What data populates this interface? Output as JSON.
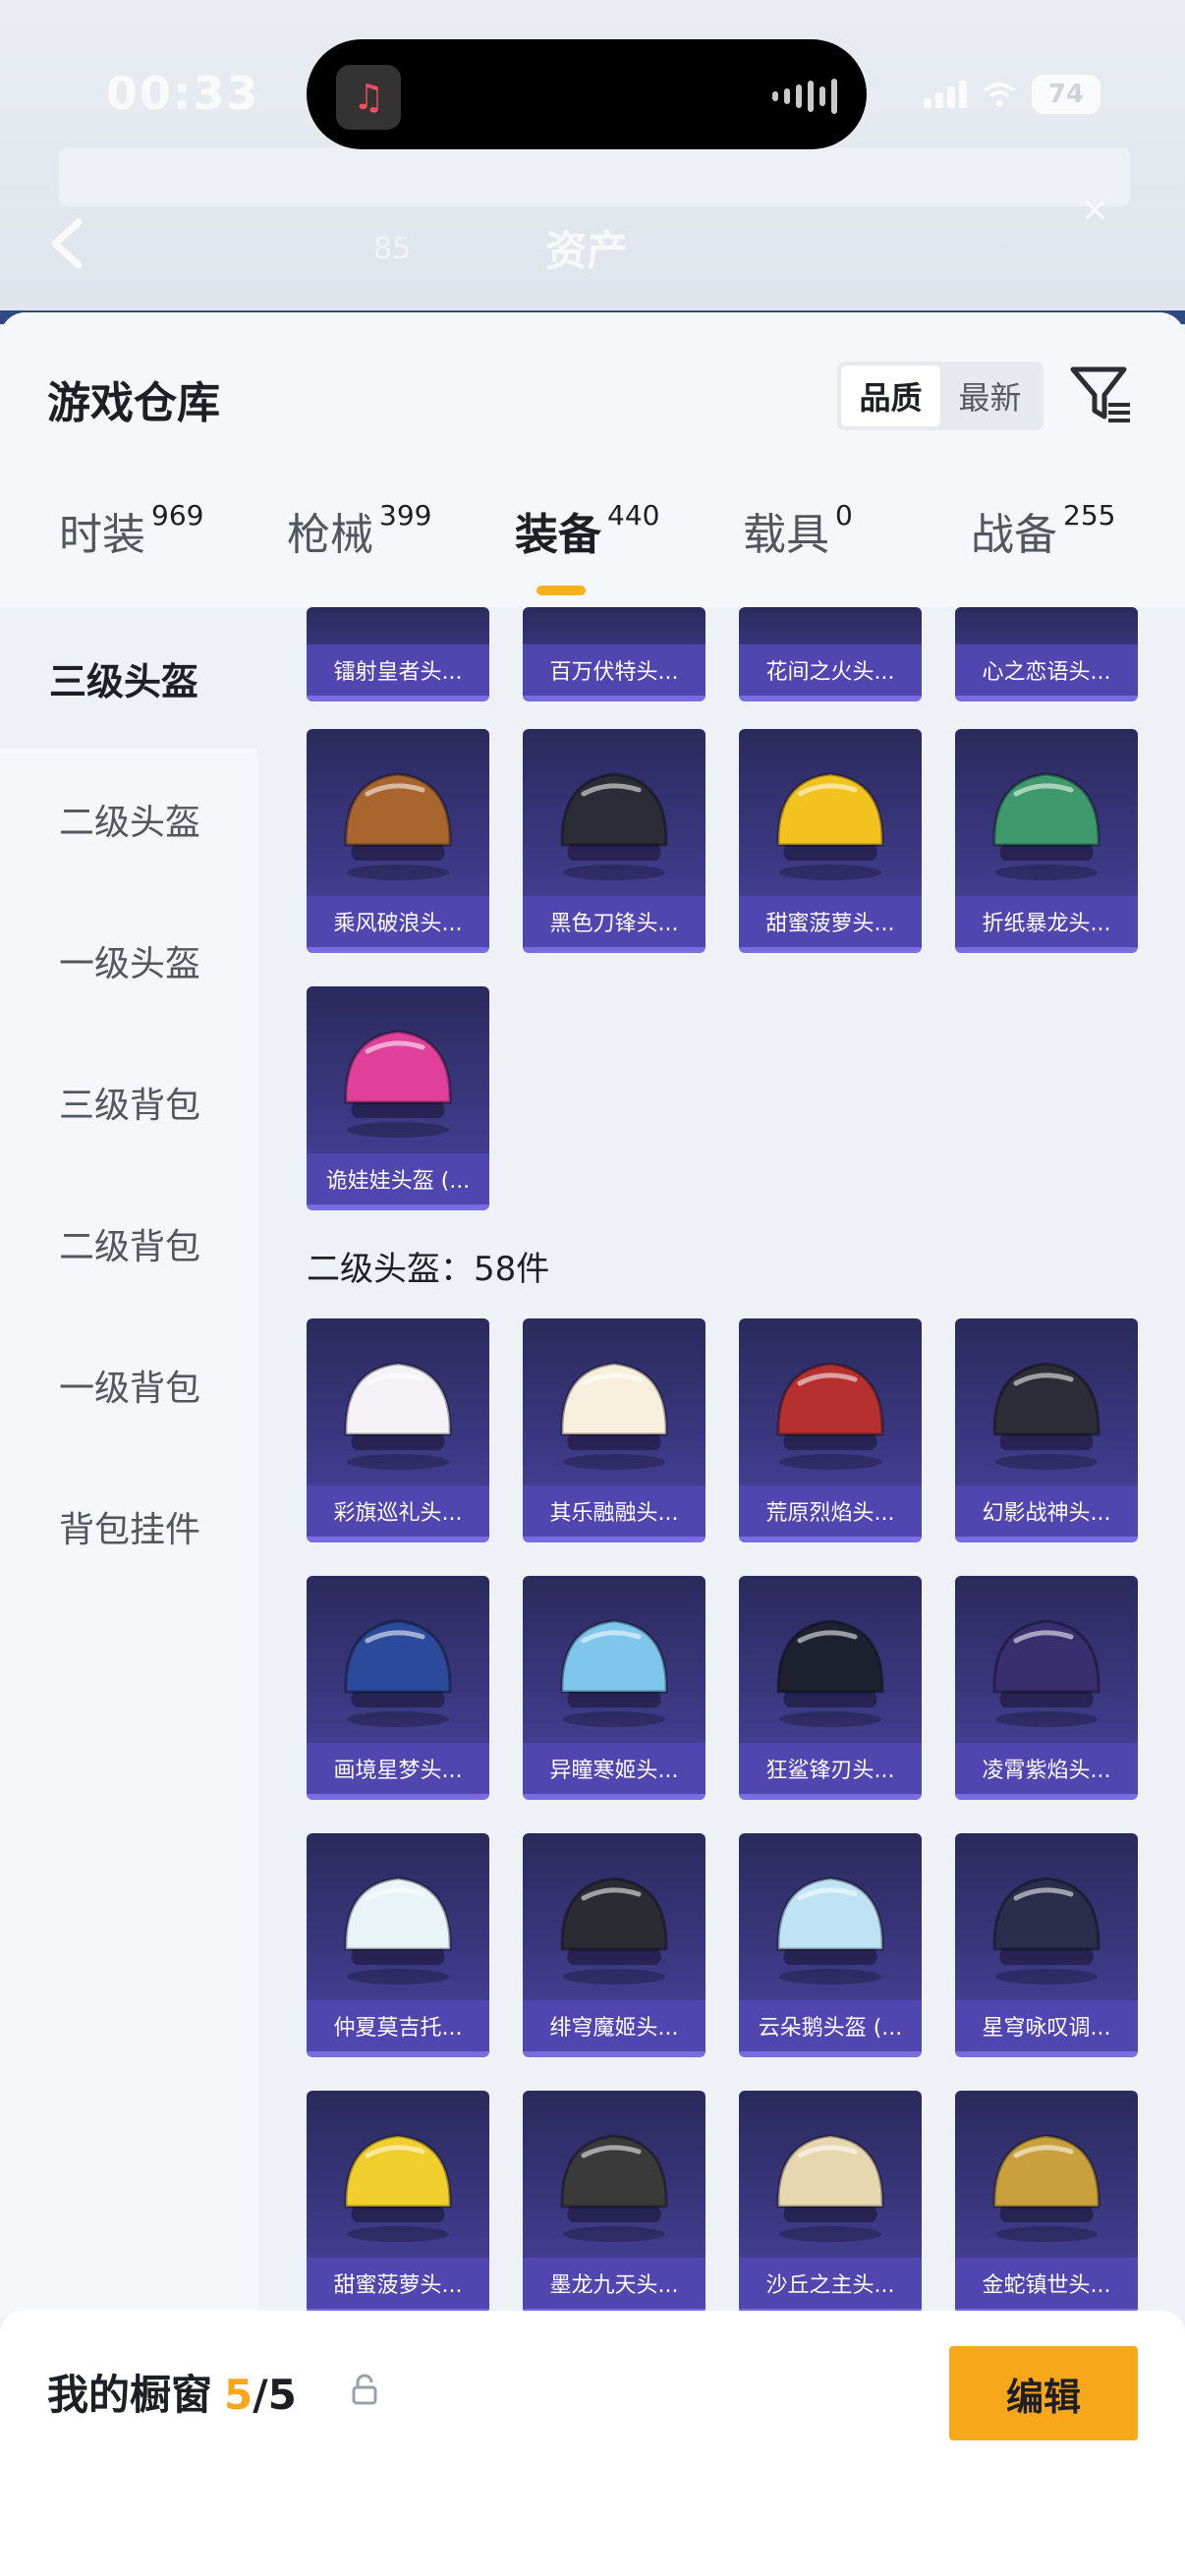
{
  "status_bar": {
    "time": "00:33",
    "battery": "74"
  },
  "backdrop": {
    "title": "资产",
    "left_hint": "",
    "mid_hint": "85",
    "right_hint": ""
  },
  "header": {
    "title": "游戏仓库",
    "sort": {
      "quality": "品质",
      "newest": "最新",
      "selected": "品质"
    }
  },
  "tabs": [
    {
      "label": "时装",
      "count": "969"
    },
    {
      "label": "枪械",
      "count": "399"
    },
    {
      "label": "装备",
      "count": "440",
      "active": true
    },
    {
      "label": "载具",
      "count": "0"
    },
    {
      "label": "战备",
      "count": "255"
    }
  ],
  "sidebar": {
    "items": [
      {
        "label": "三级头盔",
        "active": true
      },
      {
        "label": "二级头盔"
      },
      {
        "label": "一级头盔"
      },
      {
        "label": "三级背包"
      },
      {
        "label": "二级背包"
      },
      {
        "label": "一级背包"
      },
      {
        "label": "背包挂件"
      }
    ]
  },
  "level3_items": [
    {
      "name": "镭射皇者头...",
      "color": "#c0c4d8"
    },
    {
      "name": "百万伏特头...",
      "color": "#c0c4d8"
    },
    {
      "name": "花间之火头...",
      "color": "#c0c4d8"
    },
    {
      "name": "心之恋语头...",
      "color": "#c0c4d8"
    },
    {
      "name": "乘风破浪头...",
      "color": "#a8652e"
    },
    {
      "name": "黑色刀锋头...",
      "color": "#2a2d36"
    },
    {
      "name": "甜蜜菠萝头...",
      "color": "#f2c21e"
    },
    {
      "name": "折纸暴龙头...",
      "color": "#3e9a6c"
    },
    {
      "name": "诡娃娃头盔 (...",
      "color": "#e0409a"
    }
  ],
  "section_level2": {
    "title": "二级头盔：58件"
  },
  "level2_items": [
    {
      "name": "彩旗巡礼头...",
      "color": "#f4f2f6"
    },
    {
      "name": "其乐融融头...",
      "color": "#f7efdc"
    },
    {
      "name": "荒原烈焰头...",
      "color": "#b5302f"
    },
    {
      "name": "幻影战神头...",
      "color": "#2c2d36"
    },
    {
      "name": "画境星梦头...",
      "color": "#2b4a9c"
    },
    {
      "name": "异瞳寒姬头...",
      "color": "#7ec6ec"
    },
    {
      "name": "狂鲨锋刃头...",
      "color": "#1e2230"
    },
    {
      "name": "凌霄紫焰头...",
      "color": "#3a2f6e"
    },
    {
      "name": "仲夏莫吉托...",
      "color": "#e9f3f8"
    },
    {
      "name": "绯穹魔姬头...",
      "color": "#2b2b33"
    },
    {
      "name": "云朵鹅头盔 (...",
      "color": "#bfe2f4"
    },
    {
      "name": "星穹咏叹调...",
      "color": "#2a2e4a"
    },
    {
      "name": "甜蜜菠萝头...",
      "color": "#f0cf2c"
    },
    {
      "name": "墨龙九天头...",
      "color": "#3a3a3a"
    },
    {
      "name": "沙丘之主头...",
      "color": "#e7d7b0"
    },
    {
      "name": "金蛇镇世头...",
      "color": "#c9a03c"
    }
  ],
  "bottom": {
    "label": "我的橱窗",
    "current": "5",
    "max": "/5",
    "edit": "编辑"
  },
  "colors": {
    "accent": "#f6a81a",
    "card_bg": "#3b3780",
    "card_label": "#5145b0"
  }
}
